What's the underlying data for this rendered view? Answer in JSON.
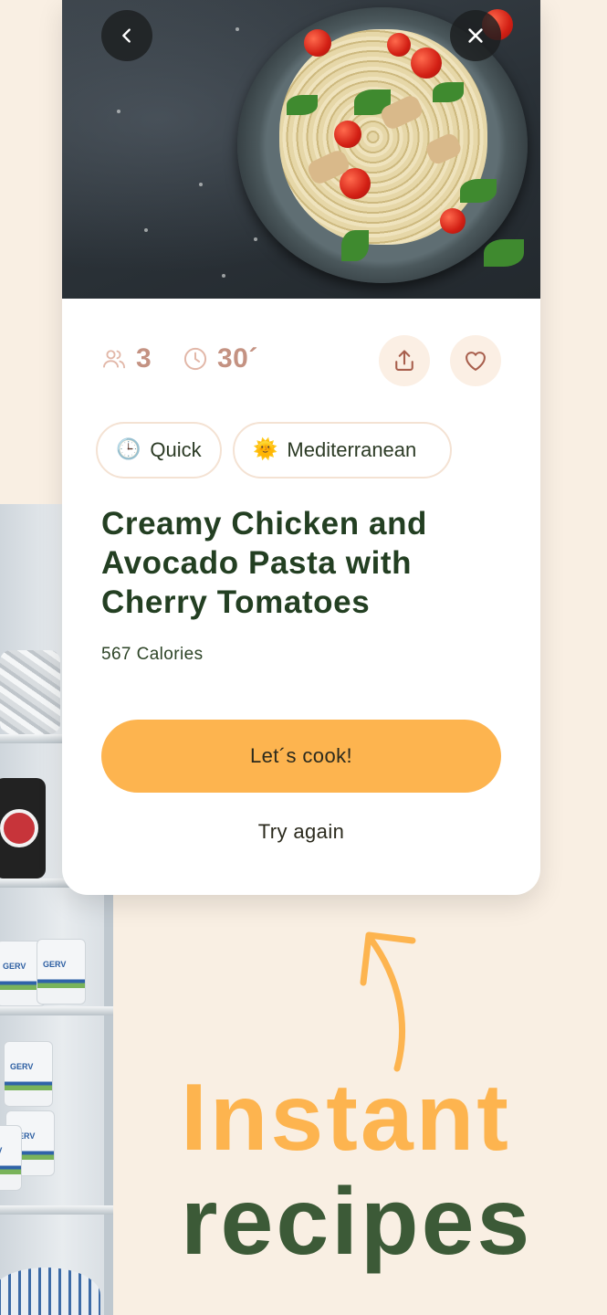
{
  "recipe": {
    "servings": "3",
    "time": "30´",
    "title": "Creamy Chicken and Avocado Pasta with Cherry Tomatoes",
    "calories": "567 Calories",
    "tags": [
      {
        "emoji": "🕒",
        "label": "Quick"
      },
      {
        "emoji": "🌞",
        "label": "Mediterranean"
      }
    ]
  },
  "actions": {
    "cook_label": "Let´s cook!",
    "try_again_label": "Try again"
  },
  "icons": {
    "back": "chevron-left-icon",
    "close": "close-icon",
    "servings": "people-icon",
    "time": "clock-icon",
    "share": "share-icon",
    "favorite": "heart-icon"
  },
  "headline": {
    "line1": "Instant",
    "line2": "recipes"
  },
  "colors": {
    "background": "#f9efe3",
    "accent_orange": "#fdb44f",
    "dark_green": "#233f22",
    "headline_green": "#3c5a37",
    "stat_rose": "#c49282",
    "soft_peach": "#fbefe4"
  }
}
